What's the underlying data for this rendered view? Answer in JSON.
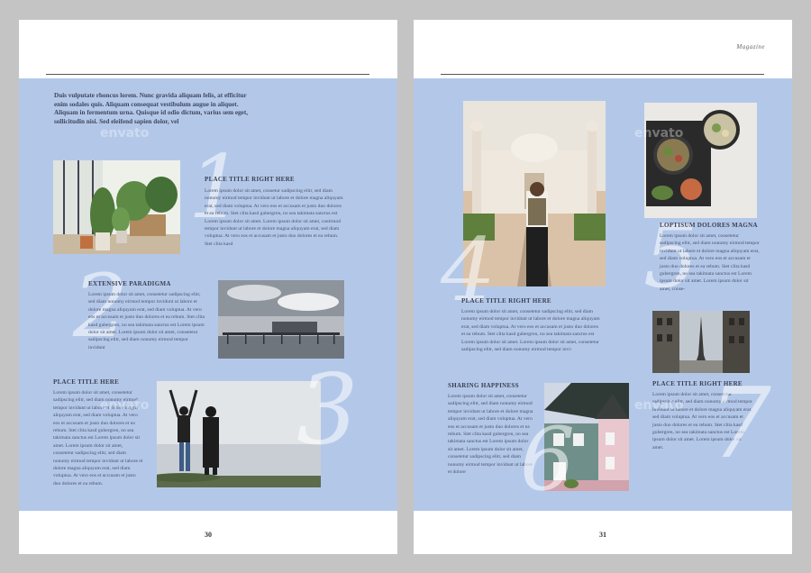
{
  "left_page": {
    "lead": "Duis vulputate rhoncus lorem. Nunc gravida aliquam felis, at efficitur enim sodales quis. Aliquam consequat vestibulum augue in aliquet. Aliquam in fermentum urna. Quisque id odio dictum, varius sem eget, sollicitudin nisi. Sed eleifend sapien dolor, vel",
    "section1": {
      "num": "1",
      "title": "PLACE TITLE RIGHT HERE",
      "body": "Lorem ipsum dolor sit amet, consetur sadipscing elitr, sed diam nonumy eirmod tempor invidunt ut labore et dolore magna aliquyam erat, sed diam voluptua. At vero eos et accusam et justo duo dolores et ea rebum. Stet clita kasd gubergren, no sea takimata sanctus est Lorem ipsum dolor sit amet. Lorem ipsum dolor sit amet, coeirmod tempor invidunt ut labore et dolore magna aliquyam erat, sed diam voluptua. At vero eos et accusam et justo duo dolores et ea rebum. Stet clita kasd"
    },
    "section2": {
      "num": "2",
      "title": "EXTENSIVE PARADIGMA",
      "body": "Lorem ipsum dolor sit amet, consetetur sadipscing elitr, sed diam nonumy eirmod tempor invidunt ut labore et dolore magna aliquyam erat, sed diam voluptua. At vero eos et accusam et justo duo dolores et ea rebum. Stet clita kasd gubergren, no sea takimata sanctus est Lorem ipsum dolor sit amet. Lorem ipsum dolor sit amet, consetetur sadipscing elitr, sed diam nonumy eirmod tempor invidunt"
    },
    "section3": {
      "num": "3",
      "title": "PLACE TITLE HERE",
      "body": "Lorem ipsum dolor sit amet, consetetur sadipscing elitr, sed diam nonumy eirmod tempor invidunt ut labore et dolore magna aliquyam erat, sed diam voluptua. At vero eos et accusam et justo duo dolores et ea rebum. Stet clita kasd gubergren, no sea takimata sanctus est Lorem ipsum dolor sit amet. Lorem ipsum dolor sit amet, consetetur sadipscing elitr, sed diam nonumy eirmod tempor invidunt ut labore et dolore magna aliquyam erat, sed diam voluptua. At vero eos et accusam et justo duo dolores et ea rebum."
    },
    "page_number": "30"
  },
  "right_page": {
    "header": "Magazine",
    "section4": {
      "num": "4",
      "title": "PLACE TITLE RIGHT HERE",
      "body": "Lorem ipsum dolor sit amet, consetetur sadipscing elitr, sed diam nonumy eirmod tempor invidunt ut labore et dolore magna aliquyam erat, sed diam voluptua. At vero eos et accusam et justo duo dolores et ea rebum. Stet clita kasd gubergren, no sea takimata sanctus est Lorem ipsum dolor sit amet. Lorem ipsum dolor sit amet, consetetur sadipscing elitr, sed diam nonumy eirmod tempor invi-"
    },
    "section5": {
      "num": "5",
      "title": "LOPTISUM DOLORES MAGNA",
      "body": "Lorem ipsum dolor sit amet, consetetur sadipscing elitr, sed diam nonumy eirmod tempor invidunt ut labore et dolore magna aliquyam erat, sed diam voluptua. At vero eos et accusam et justo duo dolores et ea rebum. Stet clita kasd gubergren, no sea takimata sanctus est Lorem ipsum dolor sit amet. Lorem ipsum dolor sit amet, conse-"
    },
    "section6": {
      "num": "6",
      "title": "SHARING HAPPINESS",
      "body": "Lorem ipsum dolor sit amet, consetetur sadipscing elitr, sed diam nonumy eirmod tempor invidunt ut labore et dolore magna aliquyam erat, sed diam voluptua. At vero eos et accusam et justo duo dolores et ea rebum. Stet clita kasd gubergren, no sea takimata sanctus est Lorem ipsum dolor sit amet. Lorem ipsum dolor sit amet, consetetur sadipscing elitr, sed diam nonumy eirmod tempor invidunt ut labore et dolore"
    },
    "section7": {
      "num": "7",
      "title": "PLACE TITLE RIGHT HERE",
      "body": "Lorem ipsum dolor sit amet, consetetur sadipscing elitr, sed diam nonumy eirmod tempor invidunt ut labore et dolore magna aliquyam erat, sed diam voluptua. At vero eos et accusam et justo duo dolores et ea rebum. Stet clita kasd gubergren, no sea takimata sanctus est Lorem ipsum dolor sit amet. Lorem ipsum dolor sit amet."
    },
    "page_number": "31"
  },
  "watermark": "envato",
  "colors": {
    "band": "#b3c8e9",
    "page": "#ffffff",
    "background": "#c4c4c4",
    "heading": "#3a3f52"
  }
}
